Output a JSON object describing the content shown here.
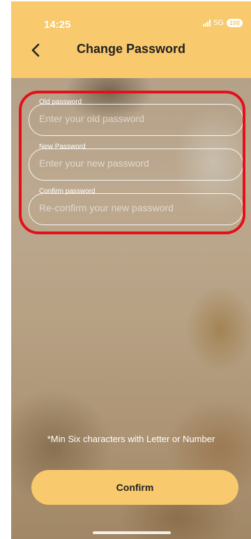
{
  "status": {
    "time": "14:25",
    "network": "5G",
    "battery": "100"
  },
  "header": {
    "title": "Change Password",
    "back_icon": "chevron-left-icon"
  },
  "form": {
    "old_password": {
      "label": "Old password",
      "placeholder": "Enter your old password"
    },
    "new_password": {
      "label": "New Password",
      "placeholder": "Enter your new password"
    },
    "confirm_password": {
      "label": "Confirm password",
      "placeholder": "Re-confirm your new password"
    }
  },
  "hint": "*Min Six characters with Letter or Number",
  "confirm_button": "Confirm",
  "colors": {
    "accent": "#f8c96d",
    "highlight": "#e3101a"
  }
}
